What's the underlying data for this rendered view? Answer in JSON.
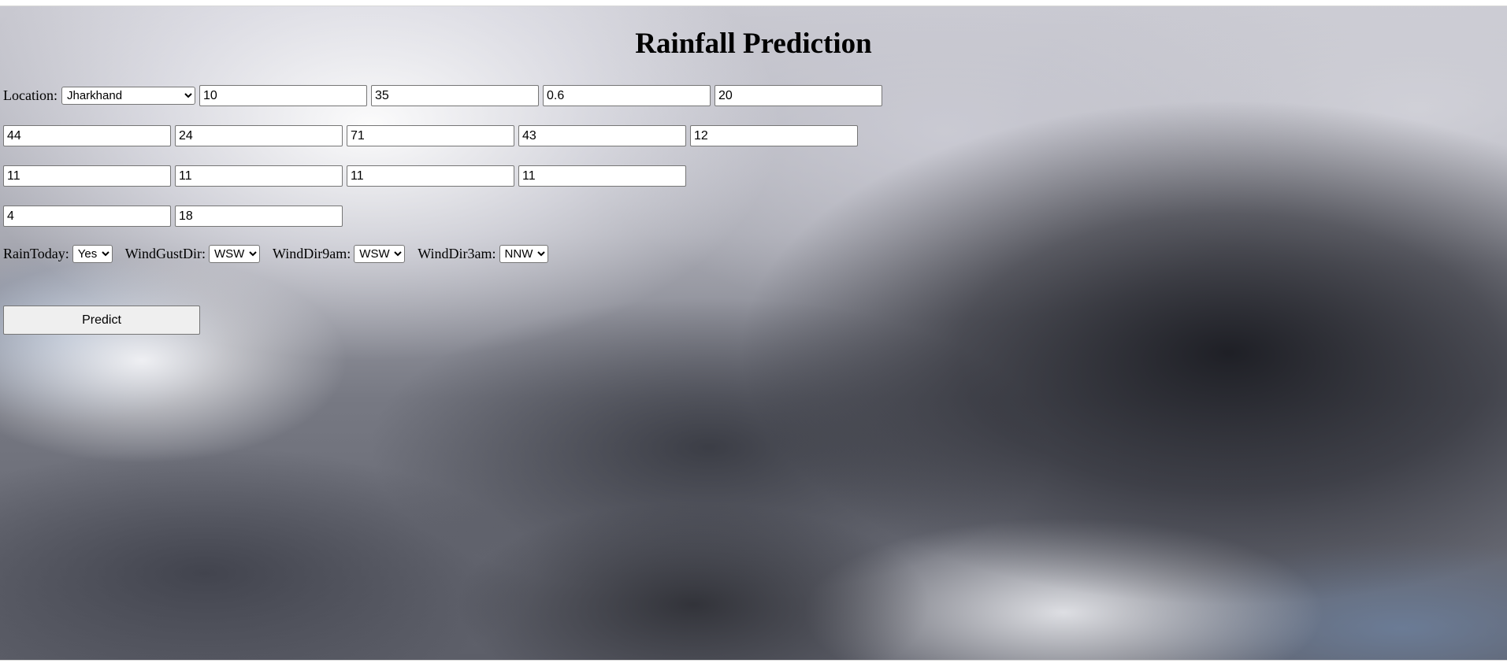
{
  "page": {
    "title": "Rainfall Prediction"
  },
  "form": {
    "location": {
      "label": "Location:",
      "selected": "Jharkhand"
    },
    "row1_values": [
      "10",
      "35",
      "0.6",
      "20"
    ],
    "row2_values": [
      "44",
      "24",
      "71",
      "43",
      "12"
    ],
    "row3_values": [
      "11",
      "11",
      "11",
      "11"
    ],
    "row4_values": [
      "4",
      "18"
    ],
    "rain_today": {
      "label": "RainToday:",
      "selected": "Yes"
    },
    "wind_gust_dir": {
      "label": "WindGustDir:",
      "selected": "WSW"
    },
    "wind_dir_9am": {
      "label": "WindDir9am:",
      "selected": "WSW"
    },
    "wind_dir_3pm": {
      "label": "WindDir3am:",
      "selected": "NNW"
    },
    "predict_button": "Predict"
  },
  "background": {
    "description_color_dark": "#2a2b31",
    "description_color_light": "#e8e8ee"
  }
}
